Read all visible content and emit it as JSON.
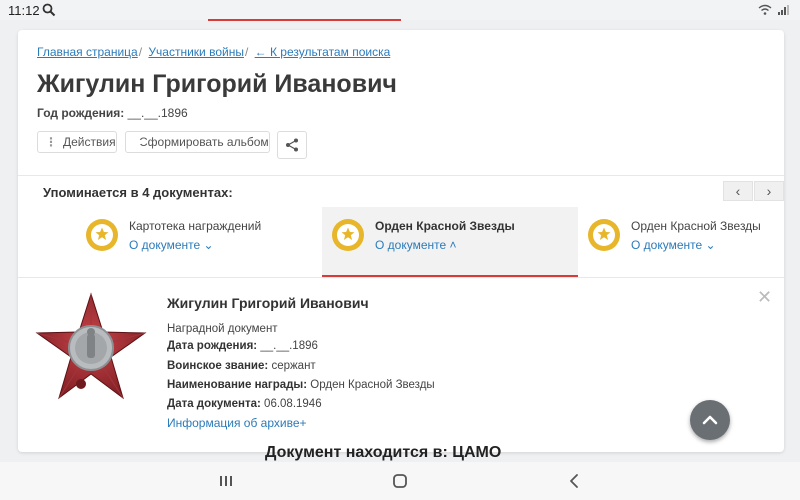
{
  "status_bar": {
    "time": "11:12"
  },
  "breadcrumb": {
    "items": [
      "Главная страница",
      "Участники войны",
      "← К результатам поиска"
    ],
    "separator": "/"
  },
  "person": {
    "name": "Жигулин Григорий Иванович",
    "birth_label": "Год рождения:",
    "birth_value": "__.__.1896"
  },
  "actions": {
    "actions_label": "Действия",
    "album_label": "Сформировать альбом"
  },
  "mentions": {
    "title": "Упоминается в 4 документах:"
  },
  "documents": [
    {
      "title": "Картотека награждений",
      "link": "О документе",
      "chevron": "chevron-down"
    },
    {
      "title": "Орден Красной Звезды",
      "link": "О документе",
      "chevron": "chevron-up",
      "active": true
    },
    {
      "title": "Орден Красной Звезды",
      "link": "О документе",
      "chevron": "chevron-down"
    }
  ],
  "detail": {
    "name": "Жигулин Григорий Иванович",
    "doc_type": "Наградной документ",
    "birth_label": "Дата рождения:",
    "birth_value": "__.__.1896",
    "rank_label": "Воинское звание:",
    "rank_value": "сержант",
    "award_label": "Наименование награды:",
    "award_value": "Орден Красной Звезды",
    "date_label": "Дата документа:",
    "date_value": "06.08.1946",
    "archive_link": "Информация об архиве+"
  },
  "underlying_text": "Документ находится в: ЦАМО",
  "colors": {
    "accent": "#d93a3a",
    "link": "#2b7bb9",
    "medal": "#e7b62b"
  }
}
